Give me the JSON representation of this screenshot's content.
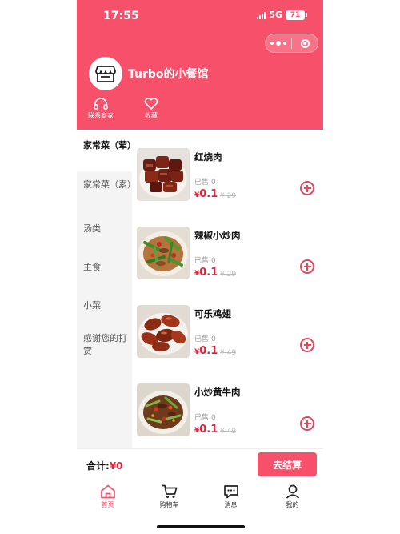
{
  "status_bar": {
    "time": "17:55",
    "network": "5G",
    "battery": "71"
  },
  "theme": {
    "primary": "#f7506a",
    "price": "#e0233b",
    "sidebar_bg": "#f4f4f4"
  },
  "capsule": {
    "more_icon": "more-dots-icon",
    "close_icon": "target-close-icon"
  },
  "store": {
    "name": "Turbo的小餐馆",
    "logo_icon": "storefront-icon",
    "actions": [
      {
        "label": "联系商家",
        "icon": "headset-icon"
      },
      {
        "label": "收藏",
        "icon": "heart-icon"
      }
    ]
  },
  "categories": [
    {
      "label": "家常菜（荤）",
      "active": true
    },
    {
      "label": "家常菜（素）",
      "active": false
    },
    {
      "label": "汤类",
      "active": false
    },
    {
      "label": "主食",
      "active": false
    },
    {
      "label": "小菜",
      "active": false
    },
    {
      "label": "感谢您的打赏",
      "active": false
    }
  ],
  "dishes": [
    {
      "name": "红烧肉",
      "sold": "已售:0",
      "currency": "¥",
      "price": "0.1",
      "original": "¥ 29"
    },
    {
      "name": "辣椒小炒肉",
      "sold": "已售:0",
      "currency": "¥",
      "price": "0.1",
      "original": "¥ 29"
    },
    {
      "name": "可乐鸡翅",
      "sold": "已售:0",
      "currency": "¥",
      "price": "0.1",
      "original": "¥ 49"
    },
    {
      "name": "小炒黄牛肉",
      "sold": "已售:0",
      "currency": "¥",
      "price": "0.1",
      "original": "¥ 49"
    }
  ],
  "cart": {
    "total_label": "合计:",
    "total_value": "¥0",
    "checkout_label": "去结算"
  },
  "tabbar": [
    {
      "label": "首页",
      "icon": "home-icon",
      "active": true
    },
    {
      "label": "购物车",
      "icon": "cart-icon",
      "active": false
    },
    {
      "label": "消息",
      "icon": "message-icon",
      "active": false
    },
    {
      "label": "我的",
      "icon": "user-icon",
      "active": false
    }
  ]
}
